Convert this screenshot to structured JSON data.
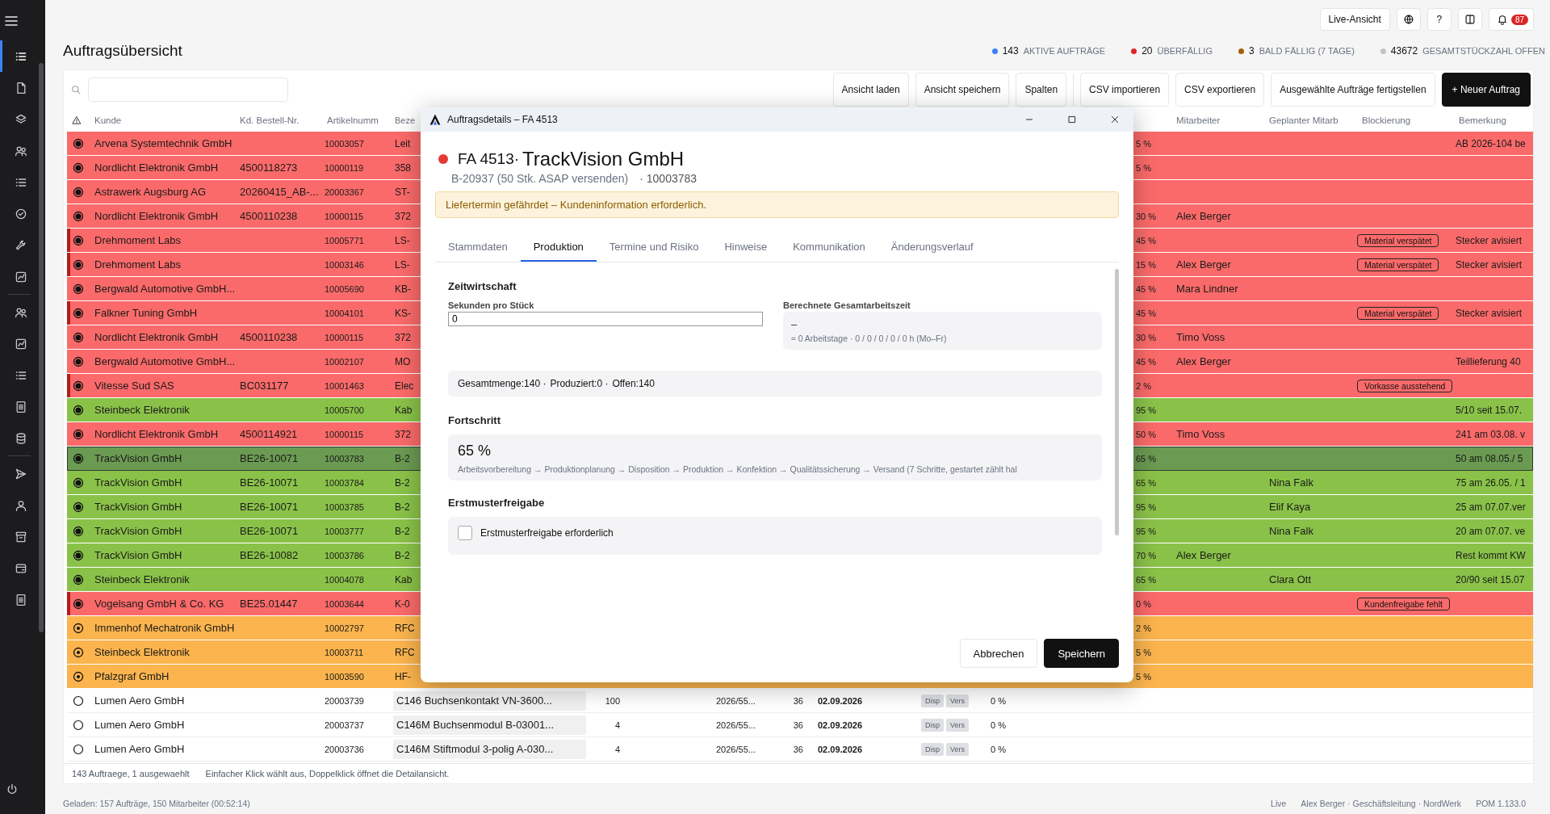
{
  "sidebar": {
    "items": [
      {
        "kind": "list",
        "selected": true
      },
      {
        "kind": "file",
        "selected": false
      },
      {
        "kind": "layers",
        "selected": false
      },
      {
        "kind": "group",
        "selected": false
      },
      {
        "kind": "list",
        "selected": false
      },
      {
        "kind": "check",
        "selected": false
      },
      {
        "kind": "wrench",
        "selected": false
      },
      {
        "kind": "chart",
        "selected": false
      },
      {
        "kind": "group",
        "selected": false
      },
      {
        "kind": "chart",
        "selected": false
      },
      {
        "kind": "list",
        "selected": false
      },
      {
        "kind": "sheet",
        "selected": false
      },
      {
        "kind": "database",
        "selected": false
      },
      {
        "kind": "send",
        "selected": false
      },
      {
        "kind": "user",
        "selected": false
      },
      {
        "kind": "archive",
        "selected": false
      },
      {
        "kind": "card",
        "selected": false
      },
      {
        "kind": "sheet",
        "selected": false
      }
    ]
  },
  "header": {
    "title": "Auftragsübersicht",
    "live_button": "Live-Ansicht",
    "help_button": "?",
    "notification_count": "87",
    "stats": [
      {
        "value": "143",
        "label": "AKTIVE AUFTRÄGE",
        "color": "#3b82f6"
      },
      {
        "value": "20",
        "label": "ÜBERFÄLLIG",
        "color": "#dc2626"
      },
      {
        "value": "3",
        "label": "BALD FÄLLIG (7 TAGE)",
        "color": "#a16207"
      },
      {
        "value": "43672",
        "label": "GESAMTSTÜCKZAHL OFFEN",
        "color": "#c4c4c4"
      }
    ]
  },
  "toolbar": {
    "buttons": [
      {
        "label": "Ansicht laden",
        "kind": "default"
      },
      {
        "label": "Ansicht speichern",
        "kind": "default"
      },
      {
        "label": "Spalten",
        "kind": "default"
      },
      {
        "label": "CSV importieren",
        "kind": "default"
      },
      {
        "label": "CSV exportieren",
        "kind": "default"
      },
      {
        "label": "Ausgewählte Aufträge fertigstellen",
        "kind": "default"
      },
      {
        "label": "+ Neuer Auftrag",
        "kind": "primary"
      }
    ]
  },
  "table": {
    "columns": [
      "Kunde",
      "Kd. Bestell-Nr.",
      "Artikelnumm",
      "Beze",
      "Mitarbeiter",
      "Geplanter Mitarb",
      "Blockierung",
      "Bemerkung"
    ],
    "rows": [
      {
        "kind": "overdue",
        "flagged": false,
        "selected": false,
        "customer": "Arvena Systemtechnik GmbH",
        "article": "10003057",
        "description": "Leit",
        "column_12": "5 %",
        "remark": "AB 2026-104 be"
      },
      {
        "kind": "overdue",
        "flagged": false,
        "selected": false,
        "customer": "Nordlicht Elektronik GmbH",
        "order_no": "4500118273",
        "article": "10000119",
        "description": "358",
        "column_12": "5 %"
      },
      {
        "kind": "overdue",
        "flagged": false,
        "selected": false,
        "customer": "Astrawerk Augsburg AG",
        "order_no": "20260415_AB-...",
        "article": "20003367",
        "description": "ST-"
      },
      {
        "kind": "overdue",
        "flagged": false,
        "selected": false,
        "customer": "Nordlicht Elektronik GmbH",
        "order_no": "4500110238",
        "article": "10000115",
        "description": "372",
        "column_12": "30 %",
        "employee": "Alex Berger"
      },
      {
        "kind": "overdue",
        "flagged": true,
        "selected": false,
        "customer": "Drehmoment Labs",
        "article": "10005771",
        "description": "LS-",
        "column_12": "45 %",
        "blocking": "Material verspätet",
        "remark": "Stecker avisiert"
      },
      {
        "kind": "overdue",
        "flagged": true,
        "selected": false,
        "customer": "Drehmoment Labs",
        "article": "10003146",
        "description": "LS-",
        "column_12": "15 %",
        "employee": "Alex Berger",
        "blocking": "Material verspätet",
        "remark": "Stecker avisiert"
      },
      {
        "kind": "overdue",
        "flagged": false,
        "selected": false,
        "customer": "Bergwald Automotive GmbH...",
        "article": "10005690",
        "description": "KB-",
        "column_12": "45 %",
        "employee": "Mara Lindner"
      },
      {
        "kind": "overdue",
        "flagged": true,
        "selected": false,
        "customer": "Falkner Tuning GmbH",
        "article": "10004101",
        "description": "KS-",
        "column_12": "45 %",
        "blocking": "Material verspätet",
        "remark": "Stecker avisiert"
      },
      {
        "kind": "overdue",
        "flagged": false,
        "selected": false,
        "customer": "Nordlicht Elektronik GmbH",
        "order_no": "4500110238",
        "article": "10000115",
        "description": "372",
        "column_12": "30 %",
        "employee": "Timo Voss"
      },
      {
        "kind": "overdue",
        "flagged": false,
        "selected": false,
        "customer": "Bergwald Automotive GmbH...",
        "article": "10002107",
        "description": "MO",
        "column_12": "45 %",
        "employee": "Alex Berger",
        "remark": "Teillieferung 40"
      },
      {
        "kind": "overdue",
        "flagged": true,
        "selected": false,
        "customer": "Vitesse Sud SAS",
        "order_no": "BC031177",
        "article": "10001463",
        "description": "Elec",
        "column_12": "2 %",
        "blocking": "Vorkasse ausstehend"
      },
      {
        "kind": "done",
        "flagged": false,
        "selected": false,
        "customer": "Steinbeck Elektronik",
        "article": "10005700",
        "description": "Kab",
        "column_12": "95 %",
        "remark": "5/10  seit 15.07."
      },
      {
        "kind": "overdue",
        "flagged": false,
        "selected": false,
        "customer": "Nordlicht Elektronik GmbH",
        "order_no": "4500114921",
        "article": "10000115",
        "description": "372",
        "column_12": "50 %",
        "employee": "Timo Voss",
        "remark": "241 am 03.08. v"
      },
      {
        "kind": "done",
        "flagged": false,
        "selected": true,
        "customer": "TrackVision GmbH",
        "order_no": "BE26-10071",
        "article": "10003783",
        "description": "B-2",
        "column_12": "65 %",
        "remark": "50 am 08.05./ 5"
      },
      {
        "kind": "done",
        "flagged": false,
        "selected": false,
        "customer": "TrackVision GmbH",
        "order_no": "BE26-10071",
        "article": "10003784",
        "description": "B-2",
        "column_12": "65 %",
        "planned_employee": "Nina Falk",
        "remark": "75 am 26.05. / 1"
      },
      {
        "kind": "done",
        "flagged": false,
        "selected": false,
        "customer": "TrackVision GmbH",
        "order_no": "BE26-10071",
        "article": "10003785",
        "description": "B-2",
        "column_12": "95 %",
        "planned_employee": "Elif Kaya",
        "remark": "25 am 07.07.ver"
      },
      {
        "kind": "done",
        "flagged": false,
        "selected": false,
        "customer": "TrackVision GmbH",
        "order_no": "BE26-10071",
        "article": "10003777",
        "description": "B-2",
        "column_12": "95 %",
        "planned_employee": "Nina Falk",
        "remark": "20 am 07.07. ve"
      },
      {
        "kind": "done",
        "flagged": false,
        "selected": false,
        "customer": "TrackVision GmbH",
        "order_no": "BE26-10082",
        "article": "10003786",
        "description": "B-2",
        "column_12": "70 %",
        "employee": "Alex Berger",
        "remark": "Rest kommt KW"
      },
      {
        "kind": "done",
        "flagged": false,
        "selected": false,
        "customer": "Steinbeck Elektronik",
        "article": "10004078",
        "description": "Kab",
        "column_12": "65 %",
        "planned_employee": "Clara Ott",
        "remark": "20/90 seit 15.07"
      },
      {
        "kind": "overdue",
        "flagged": true,
        "selected": false,
        "customer": "Vogelsang GmbH & Co. KG",
        "order_no": "BE25.01447",
        "article": "10003644",
        "description": "K-0",
        "column_12": "0 %",
        "blocking": "Kundenfreigabe fehlt"
      },
      {
        "kind": "soon",
        "flagged": false,
        "selected": false,
        "customer": "Immenhof Mechatronik GmbH",
        "article": "10002797",
        "description": "RFC",
        "column_12": "2 %"
      },
      {
        "kind": "soon",
        "flagged": false,
        "selected": false,
        "customer": "Steinbeck Elektronik",
        "article": "10003711",
        "description": "RFC",
        "column_12": "5 %"
      },
      {
        "kind": "soon",
        "flagged": false,
        "selected": false,
        "customer": "Pfalzgraf GmbH",
        "article": "10003590",
        "description": "HF-",
        "column_12": "5 %"
      },
      {
        "kind": "open",
        "flagged": false,
        "selected": false,
        "customer": "Lumen Aero GmbH",
        "article": "20003739",
        "description": "C146 Buchsenkontakt VN-3600...",
        "column_6": "100",
        "column_7": "2026/55...",
        "column_8": "36",
        "column_9": "02.09.2026",
        "column_10": [
          "Disp",
          "Vers"
        ],
        "column_11": "0 %"
      },
      {
        "kind": "open",
        "flagged": false,
        "selected": false,
        "customer": "Lumen Aero GmbH",
        "article": "20003737",
        "description": "C146M Buchsenmodul B-03001...",
        "column_6": "4",
        "column_7": "2026/55...",
        "column_8": "36",
        "column_9": "02.09.2026",
        "column_10": [
          "Disp",
          "Vers"
        ],
        "column_11": "0 %"
      },
      {
        "kind": "open",
        "flagged": false,
        "selected": false,
        "customer": "Lumen Aero GmbH",
        "article": "20003736",
        "description": "C146M Stiftmodul 3-polig A-030...",
        "column_6": "4",
        "column_7": "2026/55...",
        "column_8": "36",
        "column_9": "02.09.2026",
        "column_10": [
          "Disp",
          "Vers"
        ],
        "column_11": "0 %"
      }
    ]
  },
  "status_bar": {
    "count": "143 Auftraege, 1 ausgewaehlt",
    "hint": "Einfacher Klick wählt aus, Doppelklick öffnet die Detailansicht."
  },
  "footer": {
    "loaded": "Geladen: 157 Aufträge, 150 Mitarbeiter (00:52:14)",
    "mode": "Live",
    "user": "Alex Berger · Geschäftsleitung · NordWerk",
    "version": "POM 1.133.0"
  },
  "dialog": {
    "title": "Auftragsdetails – FA 4513",
    "order": "FA 4513·",
    "customer": "TrackVision GmbH",
    "subtitle": "B-20937 (50 Stk. ASAP versenden)",
    "article": "· 10003783",
    "alert": "Liefertermin gefährdet – Kundeninformation erforderlich.",
    "tabs": [
      {
        "label": "Stammdaten",
        "selected": false
      },
      {
        "label": "Produktion",
        "selected": true
      },
      {
        "label": "Termine und Risiko",
        "selected": false
      },
      {
        "label": "Hinweise",
        "selected": false
      },
      {
        "label": "Kommunikation",
        "selected": false
      },
      {
        "label": "Änderungsverlauf",
        "selected": false
      }
    ],
    "time_section": "Zeitwirtschaft",
    "seconds_label": "Sekunden pro Stück",
    "seconds_value": "0",
    "total_label": "Berechnete Gesamtarbeitszeit",
    "total_value": "–",
    "total_detail": "≈ 0  Arbeitstage · 0 / 0 / 0 / 0 / 0 h (Mo–Fr)",
    "quantities": [
      "Gesamtmenge:140 ·",
      "Produziert:0 ·",
      "Offen:140"
    ],
    "progress_section": "Fortschritt",
    "progress_value": "65 %",
    "progress_steps": "Arbeitsvorbereitung → Produktionplanung → Disposition → Produktion → Konfektion → Qualitätssicherung → Versand (7 Schritte, gestartet zählt hal",
    "sample_section": "Erstmusterfreigabe",
    "sample_label": "Erstmusterfreigabe erforderlich",
    "sample_checked": false,
    "buttons": [
      {
        "label": "Abbrechen",
        "kind": "default"
      },
      {
        "label": "Speichern",
        "kind": "primary"
      }
    ]
  }
}
